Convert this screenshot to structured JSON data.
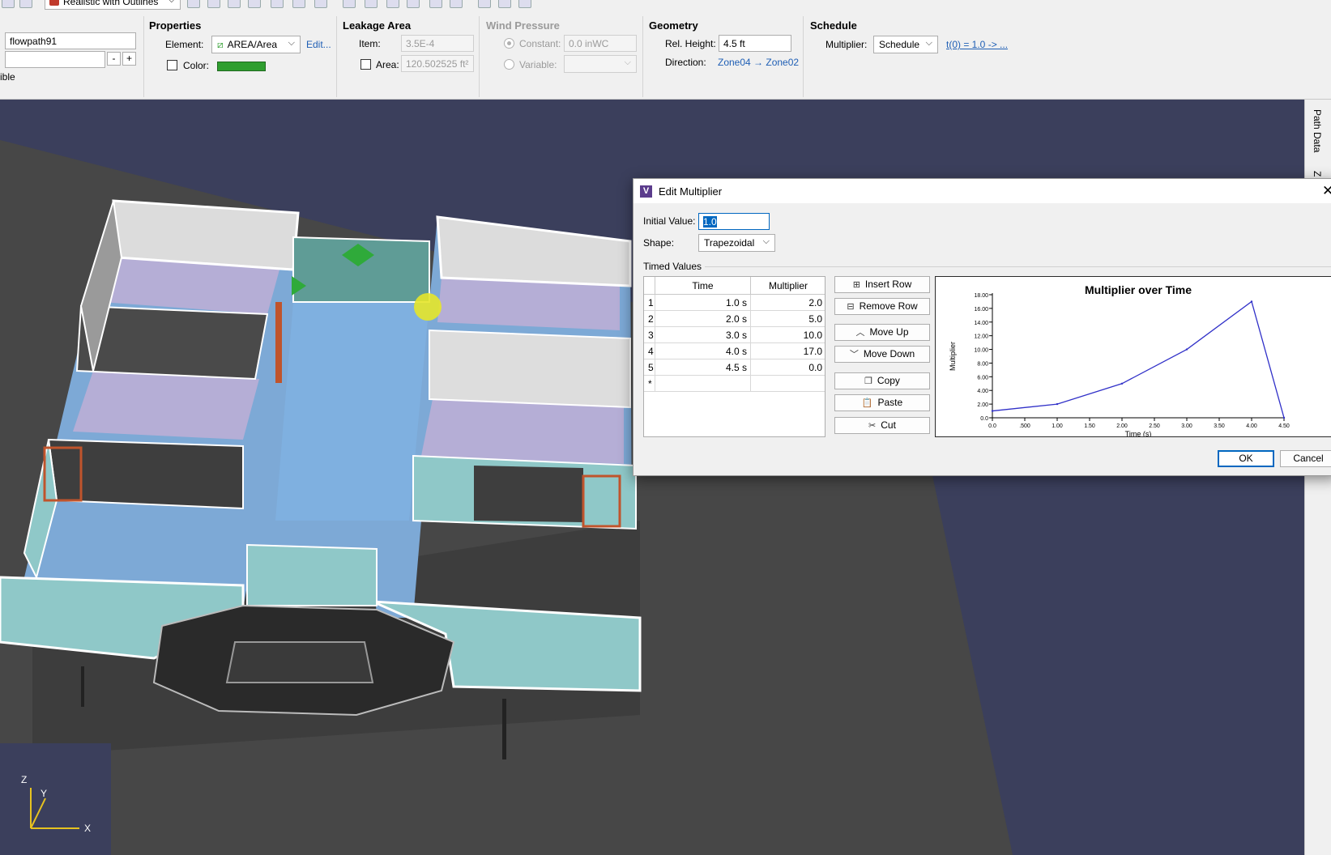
{
  "toolbar": {
    "view_mode": "Realistic with Outlines"
  },
  "left_panel": {
    "name_value": "flowpath91",
    "second_value": "",
    "minus": "-",
    "plus": "+",
    "visible_partial": "ible"
  },
  "properties": {
    "title": "Properties",
    "element_label": "Element:",
    "element_value": "AREA/Area",
    "edit_link": "Edit...",
    "color_label": "Color:",
    "color_hex": "#2f9e2f"
  },
  "leakage": {
    "title": "Leakage Area",
    "item_label": "Item:",
    "item_value": "3.5E-4",
    "area_label": "Area:",
    "area_value": "120.502525 ft²"
  },
  "wind": {
    "title": "Wind Pressure",
    "constant_label": "Constant:",
    "constant_value": "0.0 inWC",
    "variable_label": "Variable:"
  },
  "geometry": {
    "title": "Geometry",
    "rel_height_label": "Rel. Height:",
    "rel_height_value": "4.5 ft",
    "direction_label": "Direction:",
    "direction_value": "Zone04 → Zone02"
  },
  "schedule": {
    "title": "Schedule",
    "multiplier_label": "Multiplier:",
    "multiplier_value": "Schedule",
    "formula_link": "t(0) = 1.0 -> ..."
  },
  "side_tabs": [
    "Path Data",
    "Z"
  ],
  "axes": {
    "z": "Z",
    "y": "Y",
    "x": "X"
  },
  "dialog": {
    "title": "Edit Multiplier",
    "initial_value_label": "Initial Value:",
    "initial_value": "1.0",
    "shape_label": "Shape:",
    "shape_value": "Trapezoidal",
    "timed_values_label": "Timed Values",
    "table": {
      "headers": [
        "Time",
        "Multiplier"
      ],
      "rows": [
        {
          "idx": "1",
          "time": "1.0 s",
          "mult": "2.0"
        },
        {
          "idx": "2",
          "time": "2.0 s",
          "mult": "5.0"
        },
        {
          "idx": "3",
          "time": "3.0 s",
          "mult": "10.0"
        },
        {
          "idx": "4",
          "time": "4.0 s",
          "mult": "17.0"
        },
        {
          "idx": "5",
          "time": "4.5 s",
          "mult": "0.0"
        }
      ],
      "new_row_marker": "*"
    },
    "buttons": {
      "insert_row": "Insert Row",
      "remove_row": "Remove Row",
      "move_up": "Move Up",
      "move_down": "Move Down",
      "copy": "Copy",
      "paste": "Paste",
      "cut": "Cut",
      "ok": "OK",
      "cancel": "Cancel"
    }
  },
  "chart_data": {
    "type": "line",
    "title": "Multiplier over Time",
    "ylabel": "Multiplier",
    "xlabel": "Time (s)",
    "x": [
      0.0,
      1.0,
      2.0,
      3.0,
      4.0,
      4.5
    ],
    "y": [
      1.0,
      2.0,
      5.0,
      10.0,
      17.0,
      0.0
    ],
    "xlim": [
      0.0,
      4.5
    ],
    "ylim": [
      0.0,
      18.0
    ],
    "xticks": [
      "0.0",
      ".500",
      "1.00",
      "1.50",
      "2.00",
      "2.50",
      "3.00",
      "3.50",
      "4.00",
      "4.50"
    ],
    "yticks": [
      "0.0",
      "2.00",
      "4.00",
      "6.00",
      "8.00",
      "10.00",
      "12.00",
      "14.00",
      "16.00",
      "18.00"
    ],
    "line_color": "#3030c8",
    "grid": false
  }
}
